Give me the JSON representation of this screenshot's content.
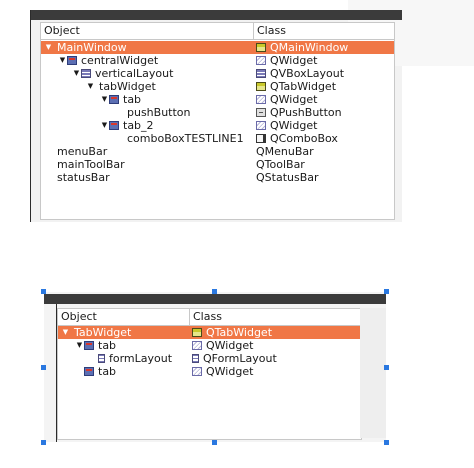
{
  "top_tree": {
    "columns": [
      "Object",
      "Class"
    ],
    "rows": [
      {
        "name": "MainWindow",
        "cls": "QMainWindow",
        "depth": 0,
        "expand": "down",
        "obj_icon": "",
        "cls_icon": "main-window-icon",
        "selected": true
      },
      {
        "name": "centralWidget",
        "cls": "QWidget",
        "depth": 1,
        "expand": "down",
        "obj_icon": "widget-tab-icon",
        "cls_icon": "widget-icon",
        "selected": false
      },
      {
        "name": "verticalLayout",
        "cls": "QVBoxLayout",
        "depth": 2,
        "expand": "down",
        "obj_icon": "vbox-layout-icon",
        "cls_icon": "vbox-layout-icon",
        "selected": false
      },
      {
        "name": "tabWidget",
        "cls": "QTabWidget",
        "depth": 3,
        "expand": "down",
        "obj_icon": "",
        "cls_icon": "tab-widget-icon",
        "selected": false
      },
      {
        "name": "tab",
        "cls": "QWidget",
        "depth": 4,
        "expand": "down",
        "obj_icon": "widget-tab-icon",
        "cls_icon": "widget-icon",
        "selected": false
      },
      {
        "name": "pushButton",
        "cls": "QPushButton",
        "depth": 5,
        "expand": "",
        "obj_icon": "",
        "cls_icon": "push-button-icon",
        "selected": false
      },
      {
        "name": "tab_2",
        "cls": "QWidget",
        "depth": 4,
        "expand": "down",
        "obj_icon": "widget-tab-icon",
        "cls_icon": "widget-icon",
        "selected": false
      },
      {
        "name": "comboBoxTESTLINE1",
        "cls": "QComboBox",
        "depth": 5,
        "expand": "",
        "obj_icon": "",
        "cls_icon": "combo-box-icon",
        "selected": false
      },
      {
        "name": "menuBar",
        "cls": "QMenuBar",
        "depth": 0,
        "expand": "",
        "obj_icon": "",
        "cls_icon": "",
        "selected": false
      },
      {
        "name": "mainToolBar",
        "cls": "QToolBar",
        "depth": 0,
        "expand": "",
        "obj_icon": "",
        "cls_icon": "",
        "selected": false
      },
      {
        "name": "statusBar",
        "cls": "QStatusBar",
        "depth": 0,
        "expand": "",
        "obj_icon": "",
        "cls_icon": "",
        "selected": false
      }
    ]
  },
  "bottom_tree": {
    "columns": [
      "Object",
      "Class"
    ],
    "rows": [
      {
        "name": "TabWidget",
        "cls": "QTabWidget",
        "depth": 0,
        "expand": "down",
        "obj_icon": "",
        "cls_icon": "tab-widget-icon",
        "selected": true
      },
      {
        "name": "tab",
        "cls": "QWidget",
        "depth": 1,
        "expand": "down",
        "obj_icon": "widget-tab-icon",
        "cls_icon": "widget-icon",
        "selected": false
      },
      {
        "name": "formLayout",
        "cls": "QFormLayout",
        "depth": 2,
        "expand": "",
        "obj_icon": "form-layout-icon",
        "cls_icon": "form-layout-icon",
        "selected": false
      },
      {
        "name": "tab",
        "cls": "QWidget",
        "depth": 1,
        "expand": "",
        "obj_icon": "widget-tab-icon",
        "cls_icon": "widget-icon",
        "selected": false
      }
    ]
  },
  "colors": {
    "selection": "#f07746",
    "handle": "#2a78e0",
    "titlebar": "#3b3b3b"
  }
}
